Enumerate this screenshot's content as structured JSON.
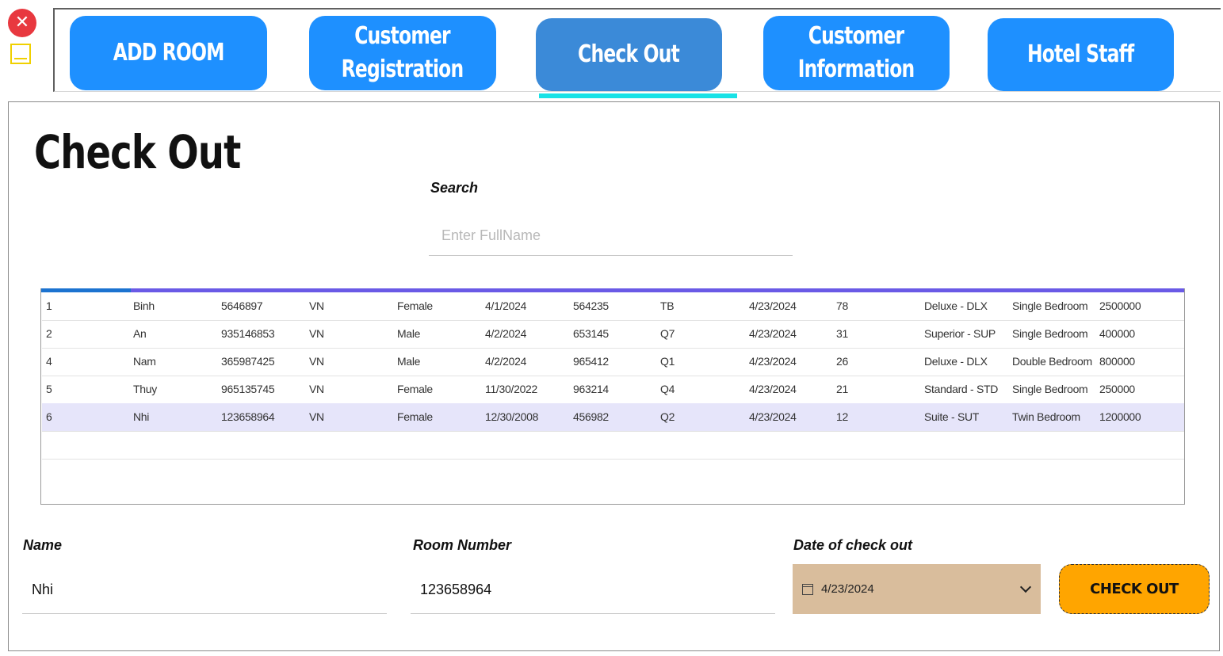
{
  "window": {
    "close_glyph": "✕"
  },
  "nav": {
    "buttons": [
      {
        "label": "ADD ROOM"
      },
      {
        "label": "Customer\nRegistration"
      },
      {
        "label": "Check Out"
      },
      {
        "label": "Customer\nInformation"
      },
      {
        "label": "Hotel Staff"
      }
    ],
    "active": "Check Out",
    "colors": {
      "button": "#1e90ff",
      "active": "#3b8ad8",
      "underline": "#18e2e6"
    }
  },
  "page": {
    "title": "Check Out"
  },
  "search": {
    "label": "Search",
    "placeholder": "Enter FullName",
    "value": ""
  },
  "table": {
    "rows": [
      [
        "1",
        "Binh",
        "5646897",
        "VN",
        "Female",
        "4/1/2024",
        "564235",
        "TB",
        "4/23/2024",
        "78",
        "Deluxe - DLX",
        "Single Bedroom",
        "2500000"
      ],
      [
        "2",
        "An",
        "935146853",
        "VN",
        "Male",
        "4/2/2024",
        "653145",
        "Q7",
        "4/23/2024",
        "31",
        "Superior - SUP",
        "Single Bedroom",
        "400000"
      ],
      [
        "4",
        "Nam",
        "365987425",
        "VN",
        "Male",
        "4/2/2024",
        "965412",
        "Q1",
        "4/23/2024",
        "26",
        "Deluxe - DLX",
        "Double Bedroom",
        "800000"
      ],
      [
        "5",
        "Thuy",
        "965135745",
        "VN",
        "Female",
        "11/30/2022",
        "963214",
        "Q4",
        "4/23/2024",
        "21",
        "Standard - STD",
        "Single Bedroom",
        "250000"
      ],
      [
        "6",
        "Nhi",
        "123658964",
        "VN",
        "Female",
        "12/30/2008",
        "456982",
        "Q2",
        "4/23/2024",
        "12",
        "Suite - SUT",
        "Twin Bedroom",
        "1200000"
      ],
      [
        "",
        "",
        "",
        "",
        "",
        "",
        "",
        "",
        "",
        "",
        "",
        "",
        ""
      ]
    ],
    "selected_row": 4
  },
  "form": {
    "name_label": "Name",
    "name_value": "Nhi",
    "room_label": "Room Number",
    "room_value": "123658964",
    "date_label": "Date of check out",
    "date_value": "4/23/2024",
    "checkout_label": "CHECK OUT"
  },
  "icons": {
    "close": "close-icon",
    "minimize": "minimize-icon",
    "calendar": "calendar-icon",
    "dropdown": "chevron-down-icon"
  }
}
